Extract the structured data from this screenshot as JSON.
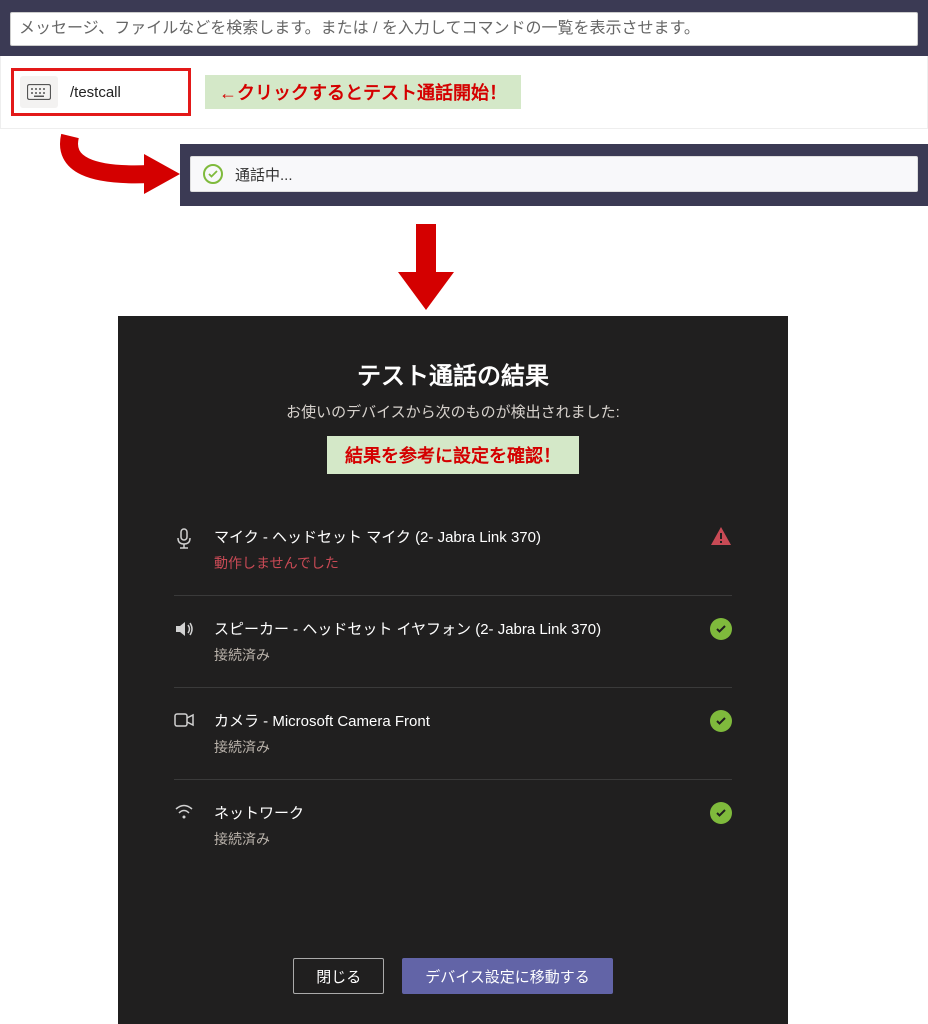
{
  "search": {
    "placeholder": "メッセージ、ファイルなどを検索します。または / を入力してコマンドの一覧を表示させます。"
  },
  "command": {
    "text": "/testcall"
  },
  "hints": {
    "click_to_start": "←クリックするとテスト通話開始！",
    "check_settings": "結果を参考に設定を確認！"
  },
  "calling": {
    "text": "通話中..."
  },
  "results": {
    "title": "テスト通話の結果",
    "subtitle": "お使いのデバイスから次のものが検出されました:",
    "devices": [
      {
        "name": "マイク - ヘッドセット マイク (2- Jabra Link 370)",
        "status": "動作しませんでした",
        "state": "error"
      },
      {
        "name": "スピーカー - ヘッドセット イヤフォン (2- Jabra Link 370)",
        "status": "接続済み",
        "state": "ok"
      },
      {
        "name": "カメラ - Microsoft Camera Front",
        "status": "接続済み",
        "state": "ok"
      },
      {
        "name": "ネットワーク",
        "status": "接続済み",
        "state": "ok"
      }
    ],
    "close_label": "閉じる",
    "goto_settings_label": "デバイス設定に移動する"
  }
}
